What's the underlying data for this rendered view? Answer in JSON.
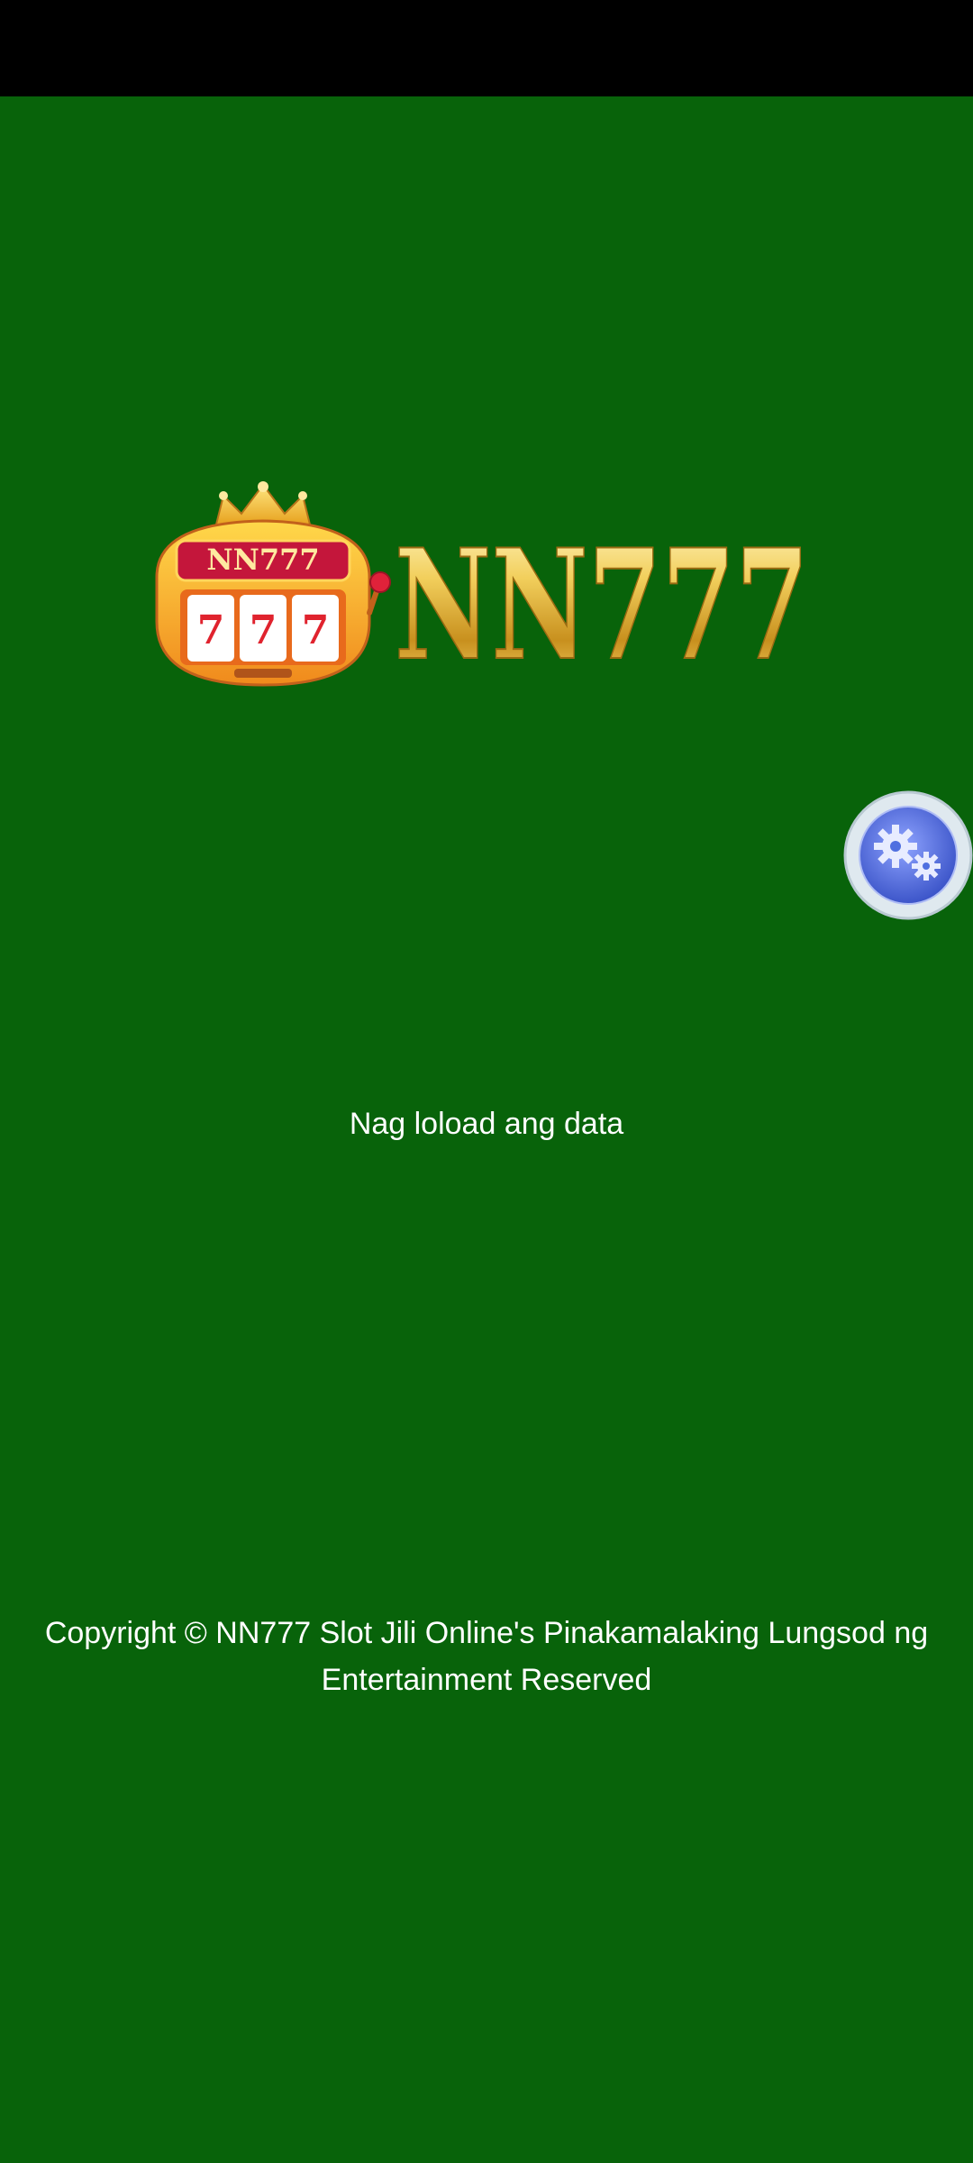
{
  "app": {
    "logo": {
      "badge_text": "NN777",
      "reels": [
        "7",
        "7",
        "7"
      ],
      "wordmark": "NN777"
    },
    "loading_text": "Nag loload ang data",
    "copyright_text": "Copyright © NN777 Slot Jili Online's Pinakamalaking Lungsod ng Entertainment Reserved",
    "settings_button": {
      "icon": "gears-icon"
    }
  },
  "colors": {
    "background": "#08630a",
    "status_bar": "#000000",
    "text": "#ffffff",
    "gold": "#e0b33a",
    "settings_blue": "#4f6fe0"
  }
}
